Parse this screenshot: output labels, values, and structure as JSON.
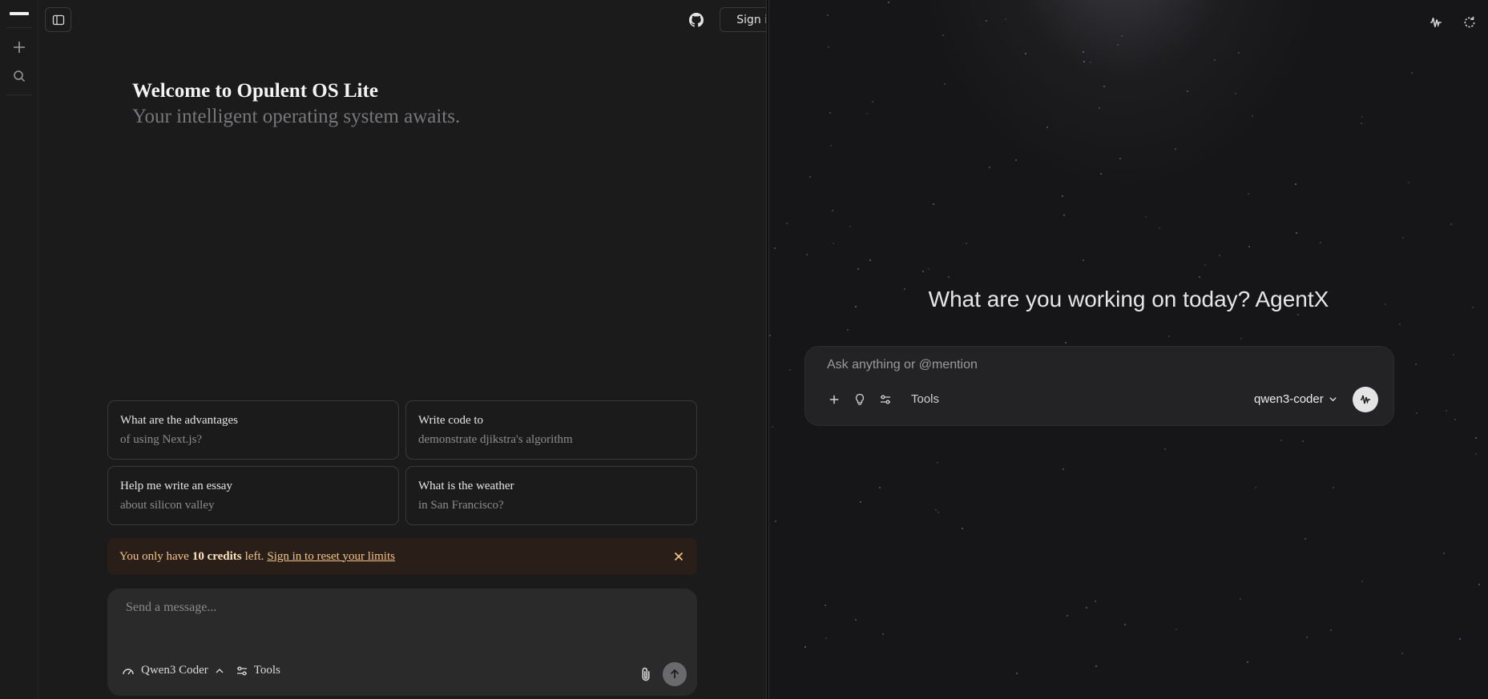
{
  "left": {
    "signin_label": "Sign in",
    "welcome_title": "Welcome to Opulent OS Lite",
    "welcome_subtitle": "Your intelligent operating system awaits.",
    "suggestions": [
      {
        "title": "What are the advantages",
        "subtitle": "of using Next.js?"
      },
      {
        "title": "Write code to",
        "subtitle": "demonstrate djikstra's algorithm"
      },
      {
        "title": "Help me write an essay",
        "subtitle": "about silicon valley"
      },
      {
        "title": "What is the weather",
        "subtitle": "in San Francisco?"
      }
    ],
    "credits": {
      "prefix": "You only have",
      "amount": "10 credits",
      "suffix": "left.",
      "link": "Sign in to reset your limits"
    },
    "composer": {
      "placeholder": "Send a message...",
      "model": "Qwen3 Coder",
      "tools": "Tools"
    }
  },
  "right": {
    "headline": "What are you working on today? AgentX",
    "input_placeholder": "Ask anything or @mention",
    "tools": "Tools",
    "model": "qwen3-coder"
  },
  "icons": {
    "rail": [
      "new-chat-icon",
      "search-icon"
    ],
    "left_header": [
      "sidebar-toggle-icon",
      "github-icon",
      "sign-in-icon"
    ],
    "right_header": [
      "voice-wave-icon",
      "refresh-icon"
    ],
    "agent_toolbar": [
      "plus-icon",
      "lightbulb-icon",
      "sliders-icon"
    ]
  },
  "colors": {
    "background": "#1b1b1c",
    "credits_bg": "#2a1f18",
    "credits_text": "#f1c48a",
    "composer_bg": "#2a2a2b"
  }
}
